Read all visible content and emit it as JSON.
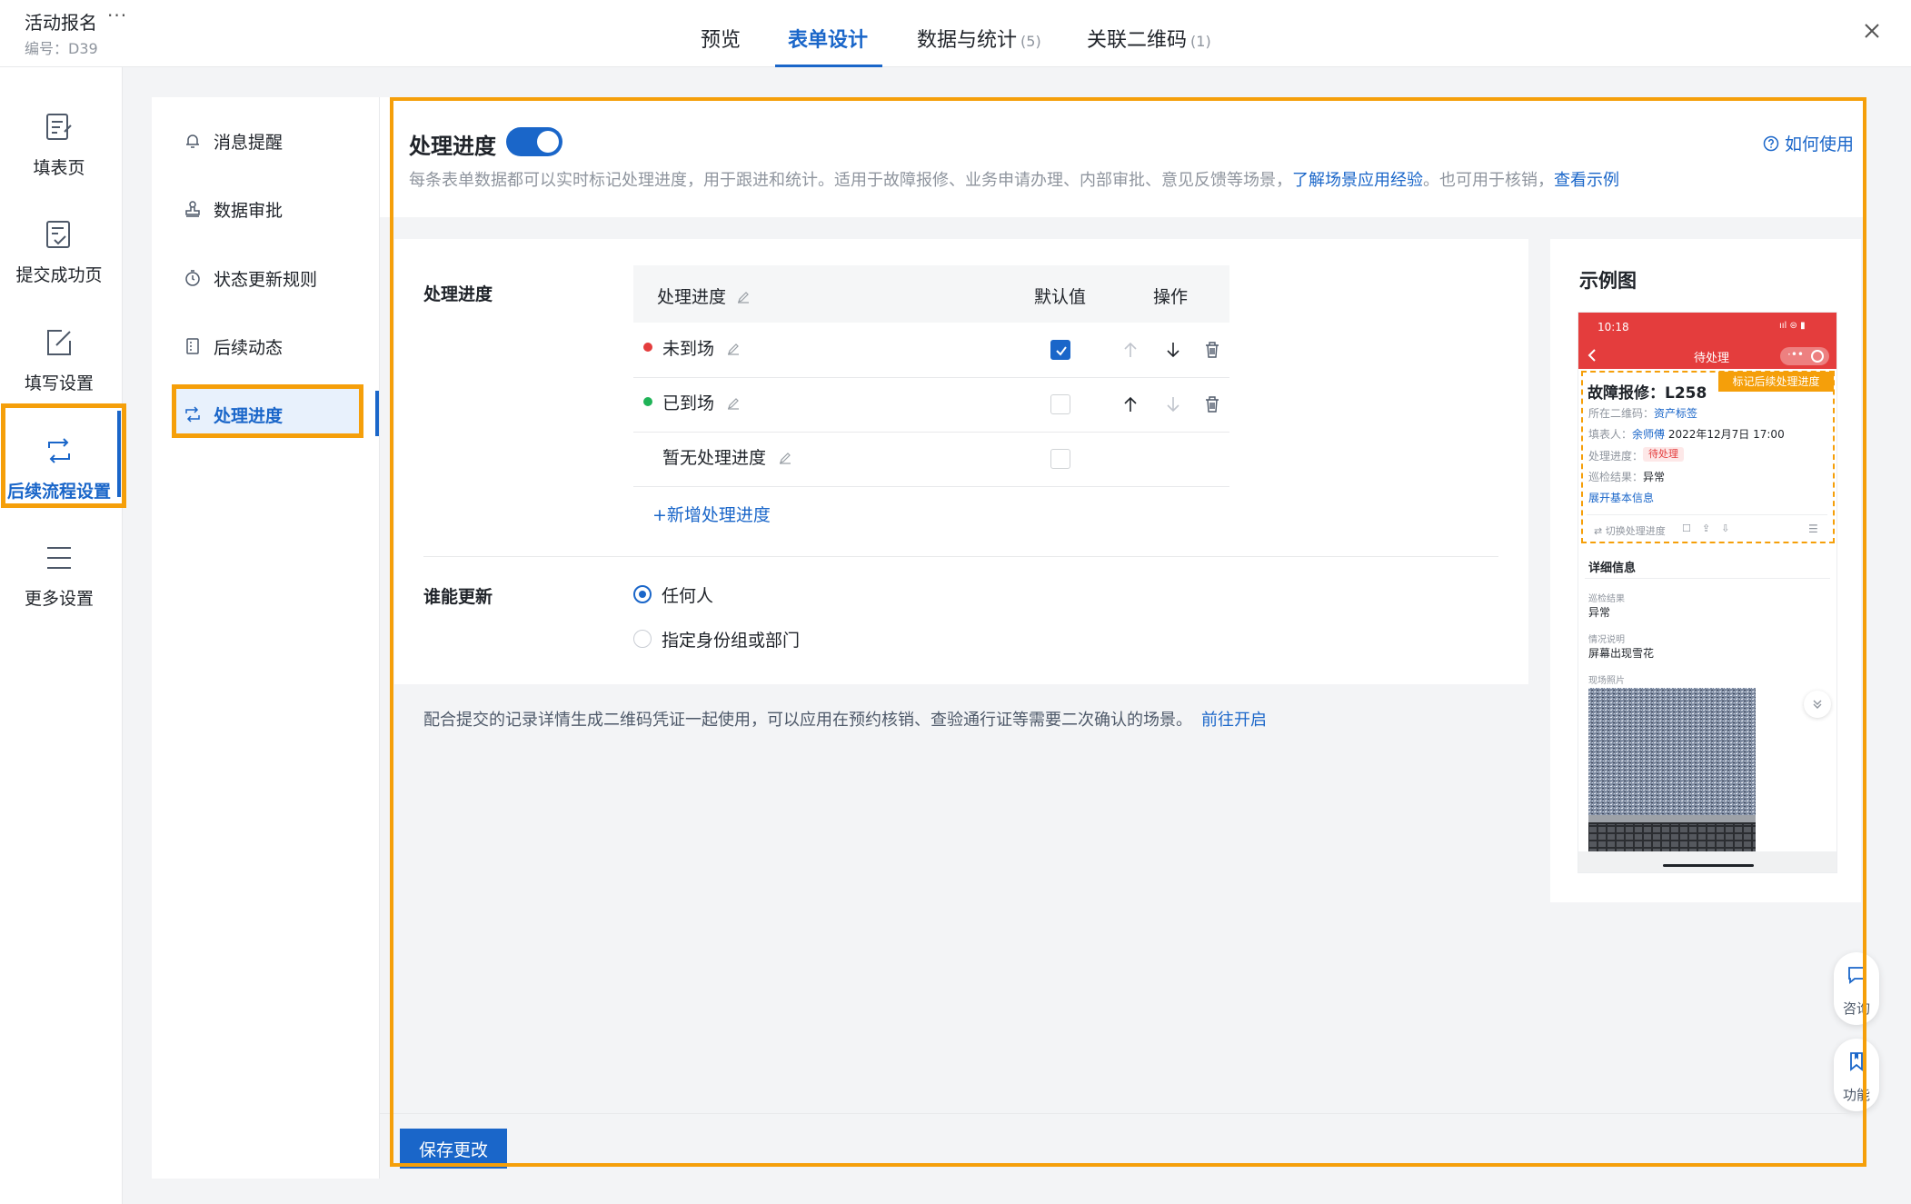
{
  "header": {
    "title": "活动报名",
    "more": "···",
    "code": "编号：D39",
    "tabs": [
      {
        "label": "预览",
        "count": ""
      },
      {
        "label": "表单设计",
        "count": ""
      },
      {
        "label": "数据与统计",
        "count": "(5)"
      },
      {
        "label": "关联二维码",
        "count": "(1)"
      }
    ]
  },
  "leftnav": {
    "items": [
      {
        "label": "填表页",
        "icon": "form-page-icon"
      },
      {
        "label": "提交成功页",
        "icon": "submit-success-icon"
      },
      {
        "label": "填写设置",
        "icon": "edit-settings-icon"
      },
      {
        "label": "后续流程设置",
        "icon": "flow-settings-icon"
      },
      {
        "label": "更多设置",
        "icon": "menu-icon"
      }
    ]
  },
  "subnav": {
    "items": [
      {
        "label": "消息提醒",
        "icon": "bell-icon"
      },
      {
        "label": "数据审批",
        "icon": "stamp-icon"
      },
      {
        "label": "状态更新规则",
        "icon": "timer-icon"
      },
      {
        "label": "后续动态",
        "icon": "document-icon"
      },
      {
        "label": "处理进度",
        "icon": "cycle-icon"
      }
    ]
  },
  "main": {
    "title": "处理进度",
    "help": "如何使用",
    "desc_prefix": "每条表单数据都可以实时标记处理进度，用于跟进和统计。适用于故障报修、业务申请办理、内部审批、意见反馈等场景，",
    "desc_link1": "了解场景应用经验",
    "desc_mid": "。也可用于核销，",
    "desc_link2": "查看示例",
    "progress_label": "处理进度",
    "table": {
      "col_name": "处理进度",
      "col_default": "默认值",
      "col_ops": "操作",
      "rows": [
        {
          "name": "未到场",
          "dot_color": "#e43d3d",
          "default": true
        },
        {
          "name": "已到场",
          "dot_color": "#1fb357",
          "default": false
        },
        {
          "name": "暂无处理进度",
          "dot_color": "",
          "default": false
        }
      ]
    },
    "add_label": "+新增处理进度",
    "who_label": "谁能更新",
    "who_options": [
      {
        "label": "任何人",
        "selected": true
      },
      {
        "label": "指定身份组或部门",
        "selected": false
      }
    ],
    "qr_text": "配合提交的记录详情生成二维码凭证一起使用，可以应用在预约核销、查验通行证等需要二次确认的场景。",
    "qr_link": "前往开启",
    "save_label": "保存更改"
  },
  "preview": {
    "title": "示例图",
    "time": "10:18",
    "status_icons": "ııl ⊜ ▮",
    "page_title": "待处理",
    "mark_tag": "标记后续处理进度",
    "fault_title": "故障报修：L258",
    "qr_label": "所在二维码：",
    "qr_value": "资产标签",
    "filler_label": "填表人：",
    "filler_name": "余师傅",
    "filler_time": "2022年12月7日 17:00",
    "progress_label": "处理进度：",
    "progress_value": "待处理",
    "result_label": "巡检结果：",
    "result_value": "异常",
    "expand": "展开基本信息",
    "switch_label": "⇄ 切换处理进度",
    "detail_title": "详细信息",
    "d_result_label": "巡检结果",
    "d_result_value": "异常",
    "d_desc_label": "情况说明",
    "d_desc_value": "屏幕出现雪花",
    "d_photo_label": "现场照片"
  },
  "fabs": [
    {
      "label": "咨询",
      "icon": "chat-icon"
    },
    {
      "label": "功能",
      "icon": "bookmark-icon"
    }
  ],
  "colors": {
    "accent": "#1a66c9",
    "highlight": "#f59f0a",
    "danger": "#e43d3d",
    "success": "#1fb357"
  }
}
